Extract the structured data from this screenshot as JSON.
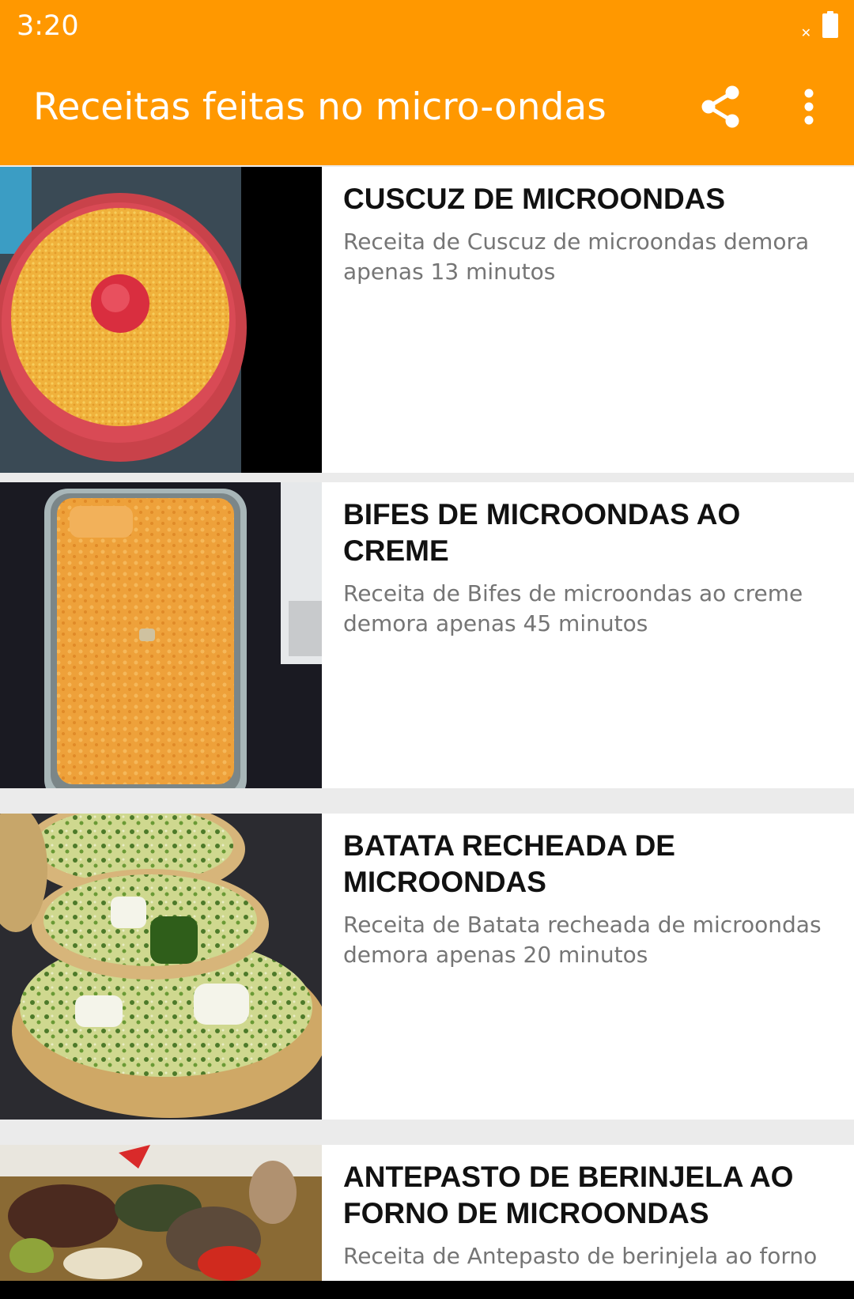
{
  "status_bar": {
    "time": "3:20",
    "icons": [
      "x-icon",
      "battery-icon"
    ]
  },
  "app_bar": {
    "title": "Receitas feitas no micro-ondas",
    "actions": [
      "share-icon",
      "more-vert-icon"
    ]
  },
  "colors": {
    "primary": "#ff9800",
    "title_text": "#111111",
    "desc_text": "#757575",
    "divider": "#ebebeb"
  },
  "recipes": [
    {
      "title": "CUSCUZ DE MICROONDAS",
      "description": "Receita de Cuscuz de microondas  demora apenas 13 minutos",
      "image": "couscous-photo"
    },
    {
      "title": "BIFES DE MICROONDAS AO CREME",
      "description": "Receita de Bifes de microondas ao creme demora apenas 45 minutos",
      "image": "creamy-steak-photo"
    },
    {
      "title": "BATATA RECHEADA DE MICROONDAS",
      "description": "Receita de Batata recheada de microondas demora apenas 20 minutos",
      "image": "stuffed-potato-photo"
    },
    {
      "title": "ANTEPASTO DE BERINJELA AO FORNO DE MICROONDAS",
      "description": "Receita de Antepasto de berinjela ao forno",
      "image": "eggplant-antipasto-photo"
    }
  ]
}
